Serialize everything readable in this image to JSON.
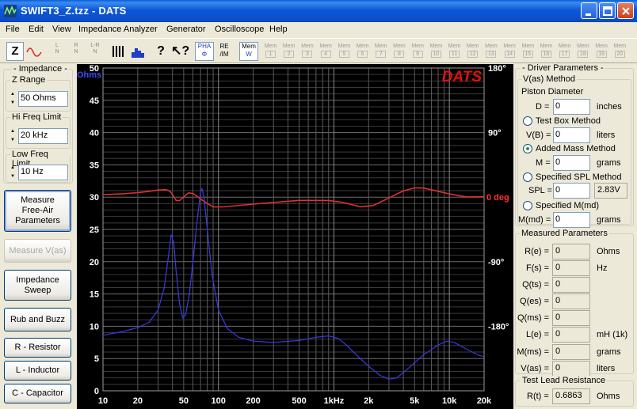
{
  "window": {
    "title": "SWIFT3_Z.tzz - DATS"
  },
  "menu": [
    "File",
    "Edit",
    "View",
    "Impedance Analyzer",
    "Generator",
    "Oscilloscope",
    "Help"
  ],
  "toolbar": {
    "z_label": "Z",
    "lr_buttons": [
      [
        "L",
        "N"
      ],
      [
        "R",
        "N"
      ],
      [
        "L-R",
        "N"
      ]
    ],
    "pha_label": [
      "PHA",
      "Φ"
    ],
    "reim_label": [
      "RE",
      "/IM"
    ],
    "mem_w_label": [
      "Mem",
      "W"
    ],
    "mem_label": "Mem",
    "mem_slots": [
      "1",
      "2",
      "3",
      "4",
      "5",
      "6",
      "7",
      "8",
      "9",
      "10",
      "11",
      "12",
      "13",
      "14",
      "15",
      "16",
      "17",
      "18",
      "19",
      "20"
    ]
  },
  "left_panel": {
    "group_title": "Impedance",
    "z_range": {
      "label": "Z Range",
      "value": "50 Ohms"
    },
    "hi_freq": {
      "label": "Hi Freq Limit",
      "value": "20 kHz"
    },
    "low_freq": {
      "label": "Low Freq Limit",
      "value": "10 Hz"
    },
    "buttons": [
      "Measure Free-Air Parameters",
      "Measure V(as)",
      "Impedance Sweep",
      "Rub and Buzz",
      "R - Resistor",
      "L - Inductor",
      "C - Capacitor"
    ]
  },
  "right_panel": {
    "driver_title": "Driver Parameters",
    "vas_method_title": "V(as) Method",
    "piston_label": "Piston Diameter",
    "d_label": "D =",
    "d_value": "0",
    "d_unit": "inches",
    "test_box_label": "Test Box Method",
    "vb_label": "V(B) =",
    "vb_value": "0",
    "vb_unit": "liters",
    "added_mass_label": "Added Mass Method",
    "m_label": "M =",
    "m_value": "0",
    "m_unit": "grams",
    "spl_method_label": "Specified SPL Method",
    "spl_label": "SPL =",
    "spl_value": "0",
    "spl_volt": "2.83V",
    "mmd_method_label": "Specified M(md)",
    "mmd_label": "M(md) =",
    "mmd_value": "0",
    "mmd_unit": "grams",
    "measured_title": "Measured Parameters",
    "measured": [
      {
        "label": "R(e) =",
        "value": "0",
        "unit": "Ohms"
      },
      {
        "label": "F(s) =",
        "value": "0",
        "unit": "Hz"
      },
      {
        "label": "Q(ts) =",
        "value": "0",
        "unit": ""
      },
      {
        "label": "Q(es) =",
        "value": "0",
        "unit": ""
      },
      {
        "label": "Q(ms) =",
        "value": "0",
        "unit": ""
      },
      {
        "label": "L(e) =",
        "value": "0",
        "unit": "mH (1k)"
      },
      {
        "label": "M(ms) =",
        "value": "0",
        "unit": "grams"
      },
      {
        "label": "V(as) =",
        "value": "0",
        "unit": "liters"
      }
    ],
    "lead_title": "Test Lead Resistance",
    "rt_label": "R(t) =",
    "rt_value": "0.6863",
    "rt_unit": "Ohms"
  },
  "chart_data": {
    "type": "line",
    "brand": "DATS",
    "ylabel": "Ohms",
    "ylim": [
      0,
      50
    ],
    "yticks": [
      "0",
      "5",
      "10",
      "15",
      "20",
      "25",
      "30",
      "35",
      "40",
      "45",
      "50"
    ],
    "xscale": "log",
    "xlim": [
      10,
      20000
    ],
    "xticks": [
      {
        "v": 10,
        "t": "10"
      },
      {
        "v": 20,
        "t": "20"
      },
      {
        "v": 50,
        "t": "50"
      },
      {
        "v": 100,
        "t": "100"
      },
      {
        "v": 200,
        "t": "200"
      },
      {
        "v": 500,
        "t": "500"
      },
      {
        "v": 1000,
        "t": "1kHz"
      },
      {
        "v": 2000,
        "t": "2k"
      },
      {
        "v": 5000,
        "t": "5k"
      },
      {
        "v": 10000,
        "t": "10k"
      },
      {
        "v": 20000,
        "t": "20k"
      }
    ],
    "phase_ticks": [
      {
        "v": 180,
        "t": "180°"
      },
      {
        "v": 90,
        "t": "90°"
      },
      {
        "v": 0,
        "t": "0 deg"
      },
      {
        "v": -90,
        "t": "-90°"
      },
      {
        "v": -180,
        "t": "-180°"
      }
    ],
    "phase_range": [
      -270,
      180
    ],
    "grid": true,
    "series": [
      {
        "color": "#3A3AE8",
        "points": [
          [
            10,
            8.6
          ],
          [
            15,
            9.2
          ],
          [
            20,
            9.8
          ],
          [
            25,
            10.6
          ],
          [
            30,
            12.5
          ],
          [
            34,
            16
          ],
          [
            37,
            21
          ],
          [
            39,
            24.2
          ],
          [
            41,
            23
          ],
          [
            43,
            18.5
          ],
          [
            46,
            13.5
          ],
          [
            49,
            11.3
          ],
          [
            52,
            11.8
          ],
          [
            56,
            15
          ],
          [
            61,
            21
          ],
          [
            66,
            27
          ],
          [
            70,
            30.8
          ],
          [
            72,
            31.3
          ],
          [
            75,
            30
          ],
          [
            80,
            25
          ],
          [
            88,
            18
          ],
          [
            100,
            12.5
          ],
          [
            120,
            9.6
          ],
          [
            150,
            8.3
          ],
          [
            200,
            7.7
          ],
          [
            300,
            7.5
          ],
          [
            500,
            7.8
          ],
          [
            700,
            8.3
          ],
          [
            900,
            8.5
          ],
          [
            1100,
            8.1
          ],
          [
            1300,
            7.0
          ],
          [
            1600,
            5.4
          ],
          [
            2000,
            3.8
          ],
          [
            2500,
            2.4
          ],
          [
            3000,
            1.8
          ],
          [
            3500,
            2.0
          ],
          [
            4500,
            3.6
          ],
          [
            6000,
            5.6
          ],
          [
            8000,
            7.1
          ],
          [
            9500,
            7.7
          ],
          [
            11000,
            7.5
          ],
          [
            14000,
            6.5
          ],
          [
            18000,
            5.5
          ],
          [
            20000,
            5.3
          ]
        ]
      },
      {
        "color": "#E03030",
        "points": [
          [
            10,
            3.5
          ],
          [
            15,
            4.7
          ],
          [
            20,
            6.3
          ],
          [
            25,
            8.1
          ],
          [
            30,
            9.9
          ],
          [
            35,
            10.5
          ],
          [
            38,
            8.3
          ],
          [
            40,
            3.5
          ],
          [
            43,
            -4.6
          ],
          [
            46,
            -5.0
          ],
          [
            50,
            0.2
          ],
          [
            55,
            6.0
          ],
          [
            60,
            5.2
          ],
          [
            65,
            1.3
          ],
          [
            75,
            -5.8
          ],
          [
            90,
            -13.7
          ],
          [
            110,
            -13.6
          ],
          [
            200,
            -9.7
          ],
          [
            500,
            -4.5
          ],
          [
            900,
            -4.6
          ],
          [
            1200,
            -7.4
          ],
          [
            1700,
            -13.5
          ],
          [
            2200,
            -11.6
          ],
          [
            3000,
            -1.1
          ],
          [
            4000,
            8.7
          ],
          [
            5000,
            12.9
          ],
          [
            6000,
            12.7
          ],
          [
            8000,
            8.2
          ],
          [
            10000,
            4.5
          ],
          [
            14000,
            0.3
          ],
          [
            20000,
            0.5
          ]
        ]
      }
    ]
  }
}
